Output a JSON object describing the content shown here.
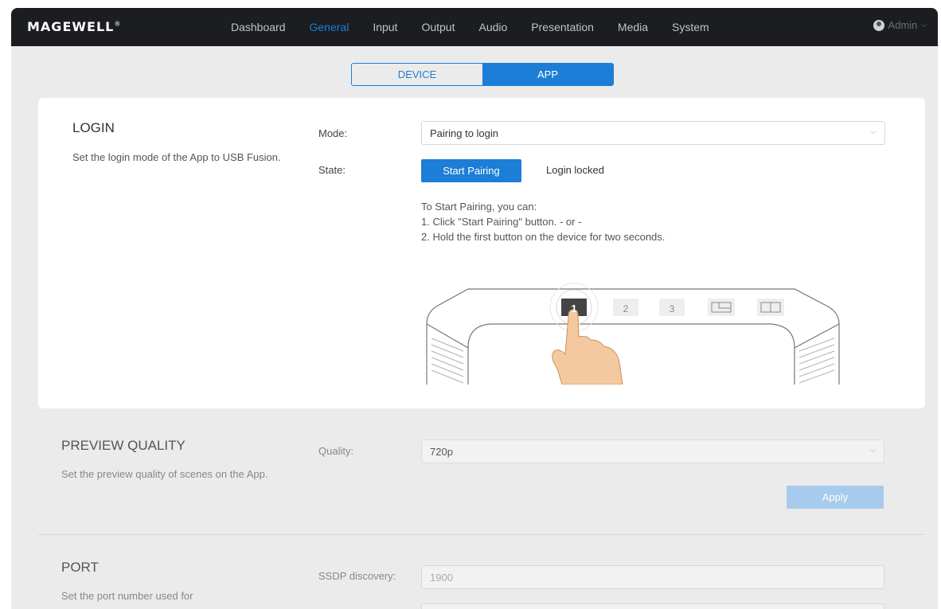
{
  "brand": {
    "logo": "MAGEWELL",
    "accent": "#1c7ed6"
  },
  "nav": {
    "items": [
      "Dashboard",
      "General",
      "Input",
      "Output",
      "Audio",
      "Presentation",
      "Media",
      "System"
    ],
    "active": "General"
  },
  "user": {
    "name": "Admin"
  },
  "tabs": {
    "device": "DEVICE",
    "app": "APP",
    "active": "APP"
  },
  "login": {
    "title": "LOGIN",
    "description": "Set the login mode of the App to USB Fusion.",
    "mode_label": "Mode:",
    "mode_value": "Pairing to login",
    "state_label": "State:",
    "start_pairing_button": "Start Pairing",
    "state_value": "Login locked",
    "instructions": [
      "To Start Pairing, you can:",
      "1. Click \"Start Pairing\" button. - or -",
      "2. Hold the first button on the device for two seconds."
    ],
    "device_buttons": [
      "1",
      "2",
      "3"
    ]
  },
  "preview_quality": {
    "title": "PREVIEW QUALITY",
    "description": "Set the preview quality of scenes on the App.",
    "quality_label": "Quality:",
    "quality_value": "720p",
    "apply_button": "Apply"
  },
  "port": {
    "title": "PORT",
    "description": "Set the port number used for",
    "ssdp_label": "SSDP discovery:",
    "ssdp_value": "1900"
  }
}
